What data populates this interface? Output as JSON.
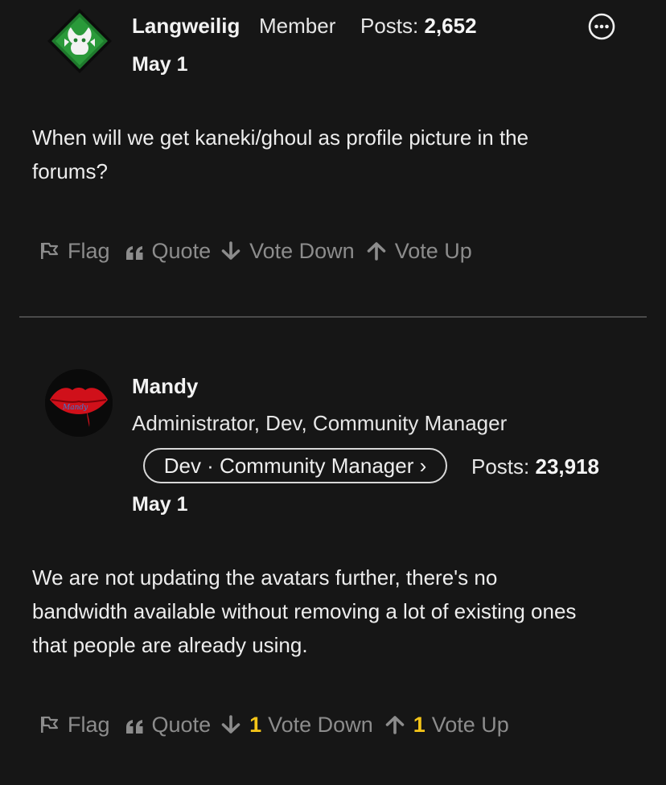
{
  "posts": [
    {
      "author": "Langweilig",
      "role": "Member",
      "posts_label": "Posts:",
      "posts_count": "2,652",
      "date": "May 1",
      "body_lines": [
        "When will we get kaneki/ghoul as profile picture in the",
        "forums?"
      ],
      "avatar_icon": "green-emblem-avatar-icon",
      "actions": {
        "flag": "Flag",
        "quote": "Quote",
        "vote_down": "Vote Down",
        "vote_up": "Vote Up"
      }
    },
    {
      "author": "Mandy",
      "role": "Administrator, Dev, Community Manager",
      "badge": "Dev · Community Manager ›",
      "posts_label": "Posts:",
      "posts_count": "23,918",
      "date": "May 1",
      "body_lines": [
        "We are not updating the avatars further, there's no",
        "bandwidth available without removing a lot of existing ones",
        "that people are already using."
      ],
      "avatar_icon": "red-lips-avatar-icon",
      "avatar_text": "Mandy",
      "actions": {
        "flag": "Flag",
        "quote": "Quote",
        "vote_down_count": "1",
        "vote_down": "Vote Down",
        "vote_up_count": "1",
        "vote_up": "Vote Up"
      }
    }
  ],
  "more_icon": "ellipsis-circle-icon",
  "colors": {
    "background": "#161616",
    "text": "#ececec",
    "muted": "#8c8c8c",
    "vote_count": "#f5c518",
    "divider": "#4a4a4a"
  }
}
